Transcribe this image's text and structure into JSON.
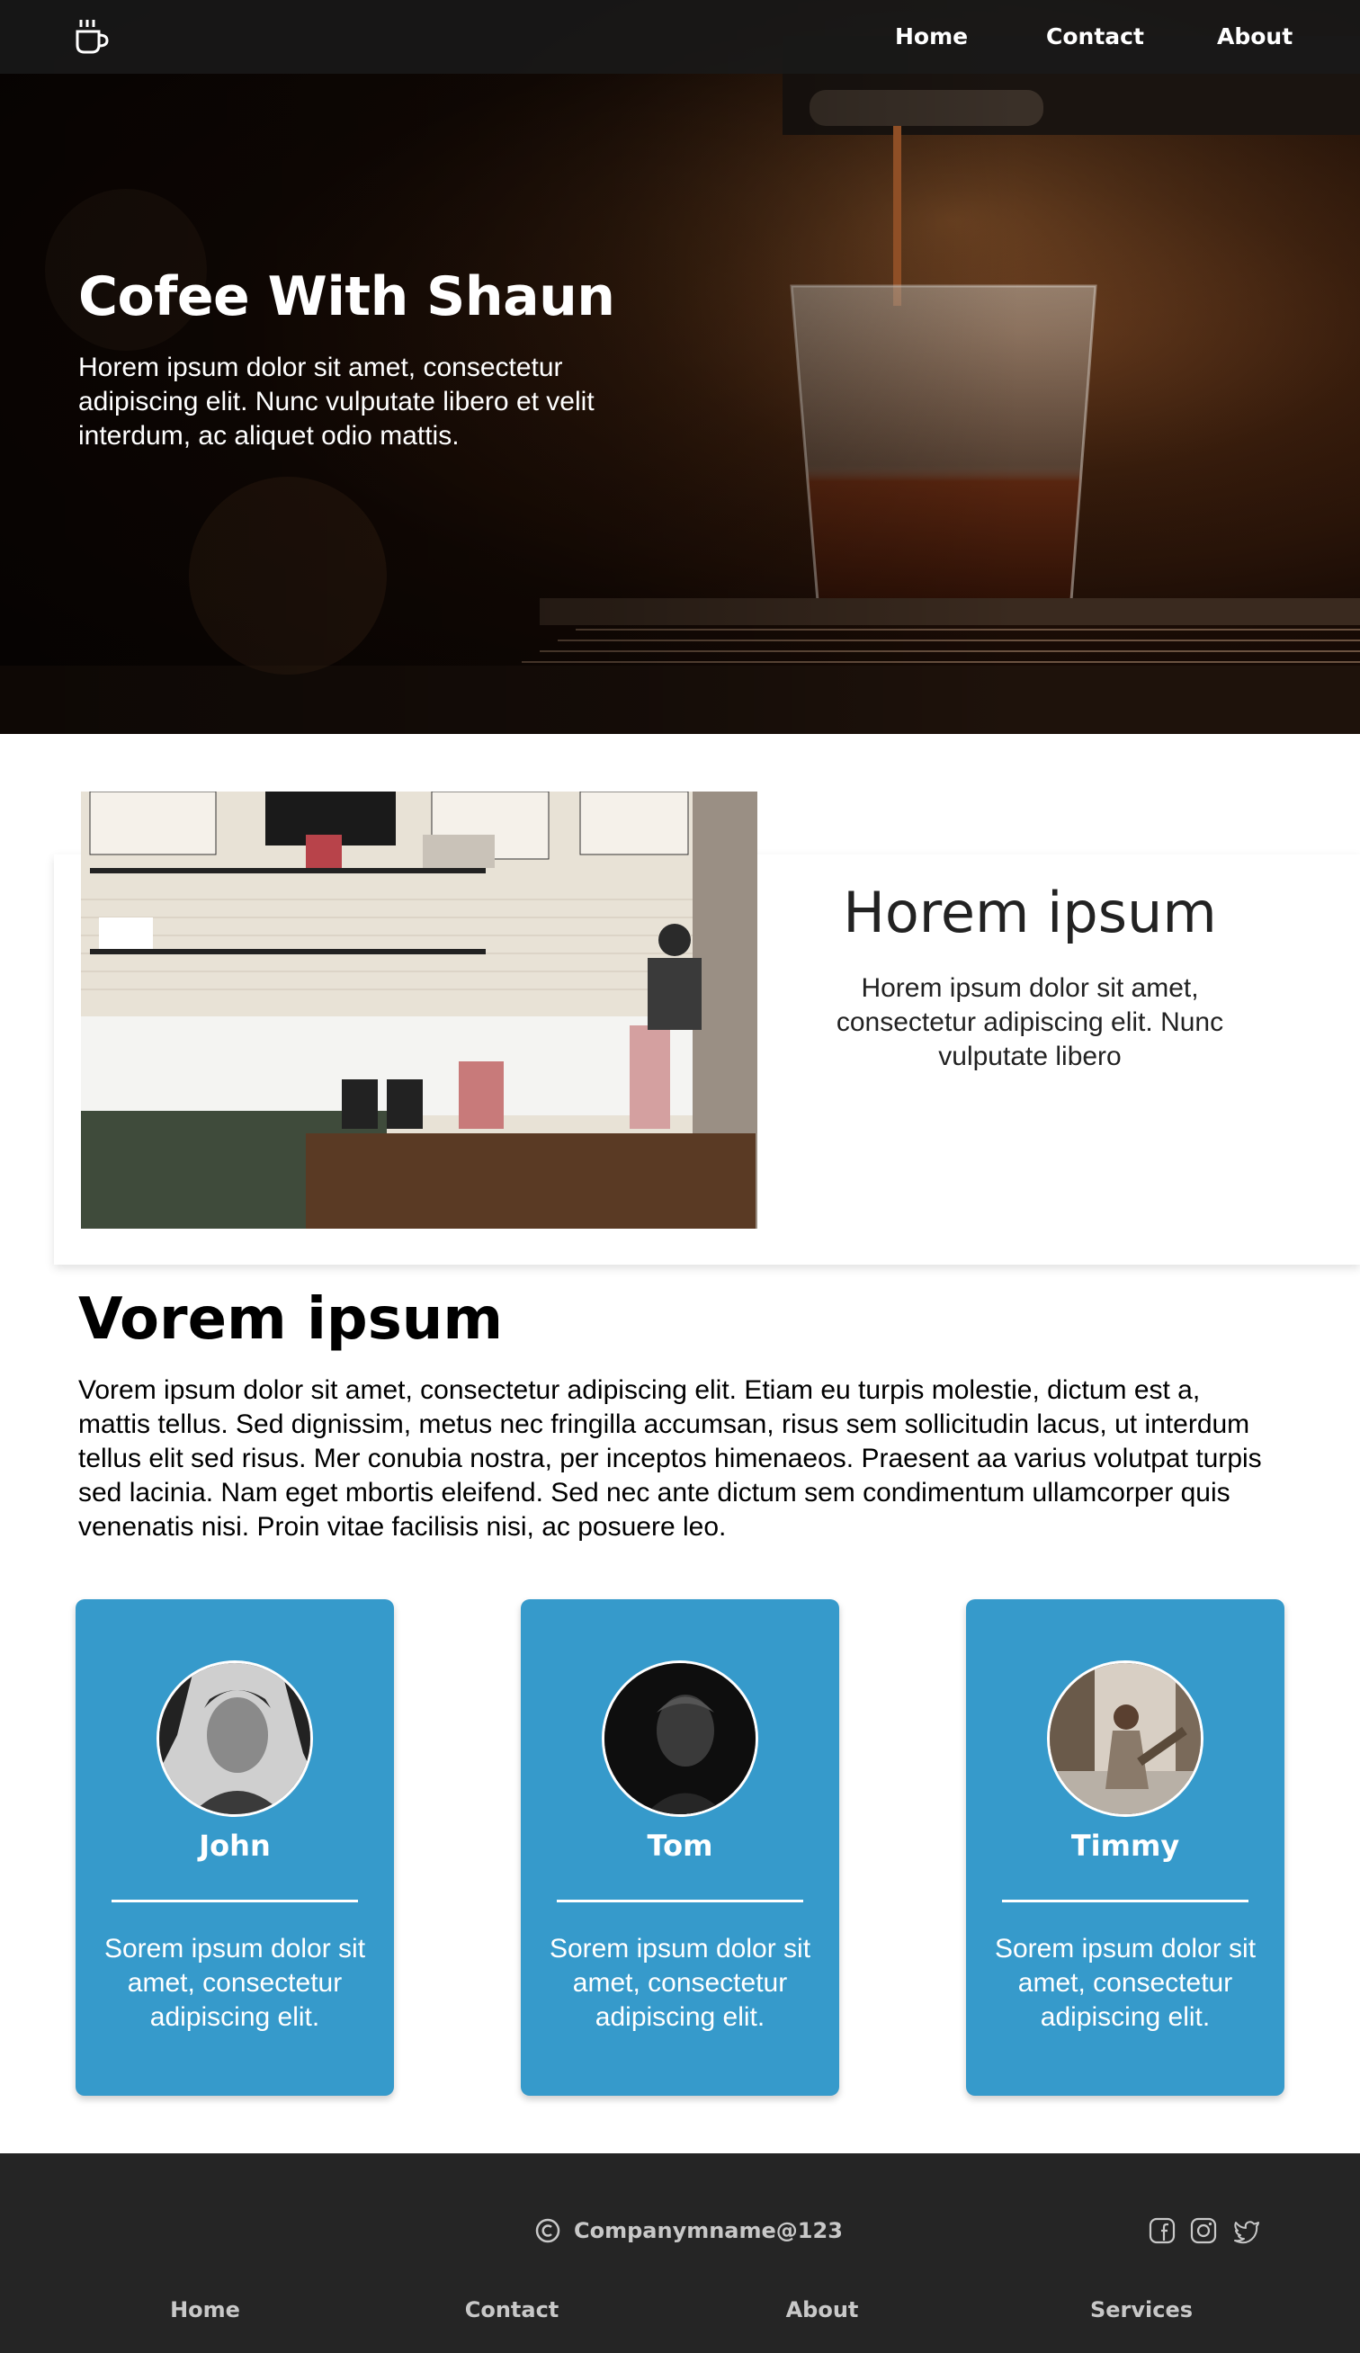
{
  "nav": {
    "logo_icon": "coffee-cup-icon",
    "links": [
      "Home",
      "Contact",
      "About"
    ]
  },
  "hero": {
    "title": "Cofee With Shaun",
    "text": "Horem ipsum dolor sit amet, consectetur adipiscing elit. Nunc vulputate libero et velit interdum, ac aliquet odio mattis."
  },
  "about": {
    "heading": "Horem ipsum",
    "text": "Horem ipsum dolor sit amet, consectetur adipiscing elit. Nunc vulputate libero"
  },
  "section": {
    "heading": "Vorem ipsum",
    "text": "Vorem ipsum dolor sit amet, consectetur adipiscing elit. Etiam eu turpis molestie, dictum est a, mattis tellus. Sed dignissim, metus nec fringilla accumsan, risus sem sollicitudin lacus, ut interdum tellus elit sed risus. Mer conubia nostra, per inceptos himenaeos. Praesent aa varius volutpat turpis sed lacinia. Nam eget mbortis eleifend. Sed nec ante dictum sem condimentum ullamcorper quis venenatis nisi. Proin vitae facilisis nisi, ac posuere leo."
  },
  "team": [
    {
      "name": "John",
      "text": "Sorem ipsum dolor sit amet, consectetur adipiscing elit."
    },
    {
      "name": "Tom",
      "text": "Sorem ipsum dolor sit amet, consectetur adipiscing elit."
    },
    {
      "name": "Timmy",
      "text": "Sorem ipsum dolor sit amet, consectetur adipiscing elit."
    }
  ],
  "footer": {
    "copyright": "Companymname@123",
    "social_icons": [
      "facebook-icon",
      "instagram-icon",
      "twitter-icon"
    ],
    "links": [
      "Home",
      "Contact",
      "About",
      "Services"
    ]
  },
  "colors": {
    "card_blue": "#369acb",
    "footer_bg": "#252525",
    "nav_bg": "#191919"
  }
}
